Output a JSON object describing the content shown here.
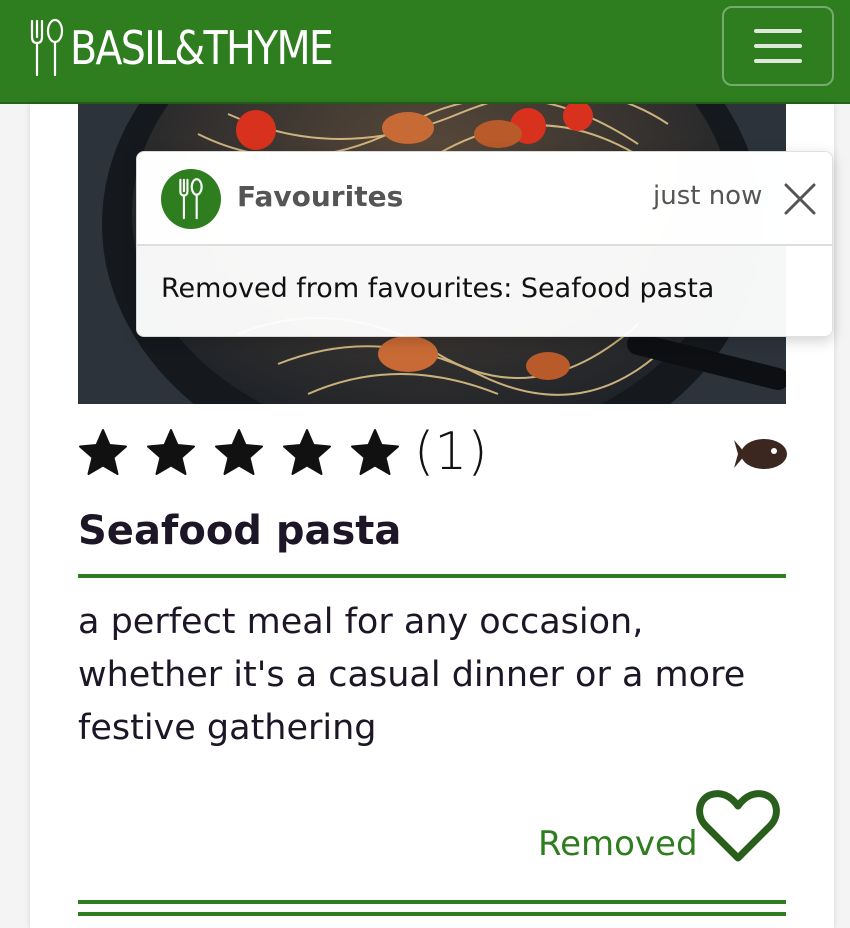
{
  "navbar": {
    "brand": "BASIL&THYME",
    "brand_icon": "fork-spoon-icon",
    "menu_icon": "hamburger-menu-icon",
    "color": "#2e7d1f"
  },
  "toast": {
    "title": "Favourites",
    "time": "just now",
    "message": "Removed from favourites: Seafood pasta",
    "icon": "fork-spoon-icon",
    "close_icon": "close-icon"
  },
  "recipe": {
    "title": "Seafood pasta",
    "rating": 5,
    "rating_count": "(1)",
    "category_icon": "fish-icon",
    "description": "a perfect meal for any occasion, whether it's a casual dinner or a more festive gathering",
    "favourite_status": "Removed",
    "favourite_icon": "heart-outline-icon"
  },
  "colors": {
    "brand_green": "#2e7d1f",
    "text_dark": "#1d1626"
  }
}
